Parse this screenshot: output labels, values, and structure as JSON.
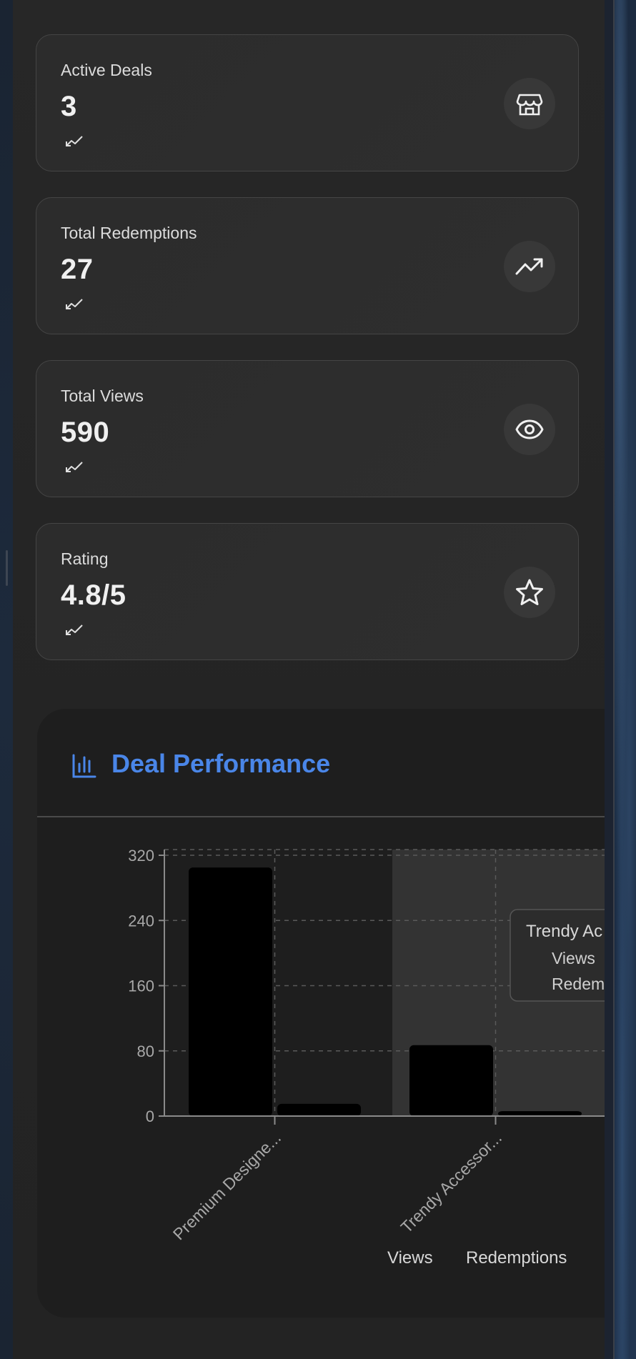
{
  "stats": [
    {
      "label": "Active Deals",
      "value": "3",
      "icon": "store-icon"
    },
    {
      "label": "Total Redemptions",
      "value": "27",
      "icon": "trending-up-icon"
    },
    {
      "label": "Total Views",
      "value": "590",
      "icon": "eye-icon"
    },
    {
      "label": "Rating",
      "value": "4.8/5",
      "icon": "star-icon"
    }
  ],
  "chart": {
    "title": "Deal Performance",
    "tooltip": {
      "title": "Trendy Ac",
      "lines": [
        "Views",
        "Redem"
      ]
    }
  },
  "colors": {
    "accent": "#4a86e8",
    "bar": "#000000"
  },
  "chart_data": {
    "type": "bar",
    "categories": [
      "Premium Designe...",
      "Trendy Accessor..."
    ],
    "series": [
      {
        "name": "Views",
        "values": [
          305,
          87
        ]
      },
      {
        "name": "Redemptions",
        "values": [
          15,
          6
        ]
      }
    ],
    "ylim": [
      0,
      320
    ],
    "yticks": [
      0,
      80,
      160,
      240,
      320
    ],
    "grid": true,
    "legend": "bottom",
    "highlighted_category": "Trendy Accessor..."
  }
}
